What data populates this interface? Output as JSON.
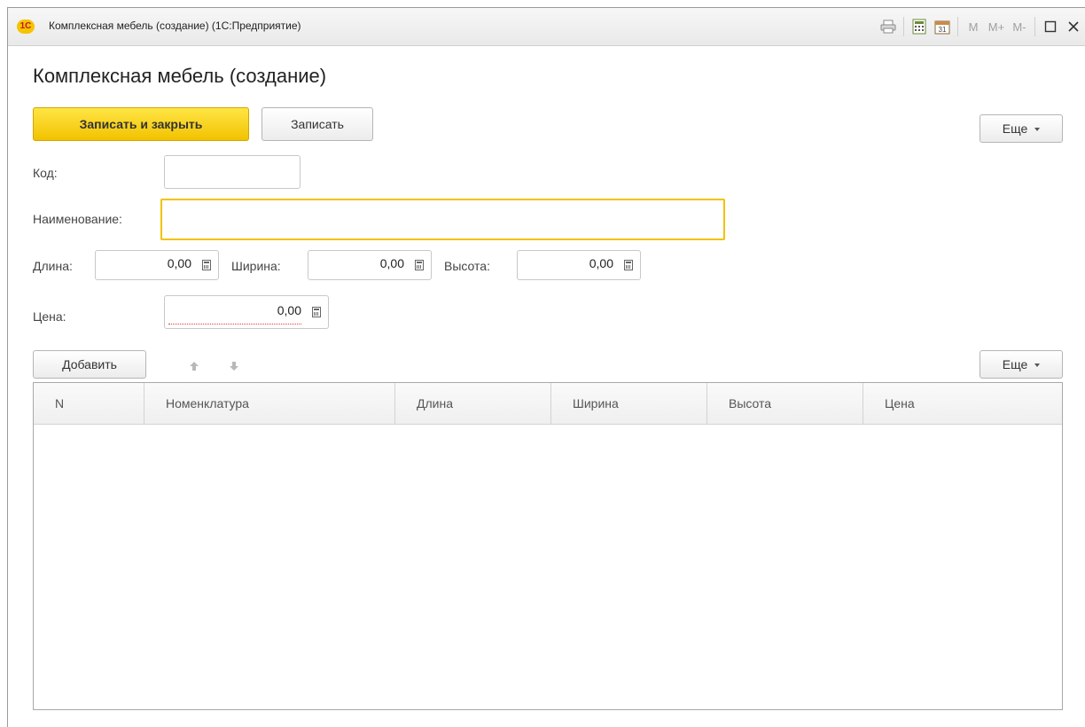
{
  "window": {
    "title": "Комплексная мебель (создание)  (1С:Предприятие)",
    "logo_text": "1С",
    "toolbar_icons": [
      "print-icon",
      "calculator-icon",
      "calendar-icon"
    ],
    "memory_buttons": [
      "M",
      "M+",
      "M-"
    ],
    "window_icons": [
      "maximize-icon",
      "close-icon"
    ]
  },
  "form": {
    "heading": "Комплексная мебель (создание)",
    "toolbar": {
      "save_close_label": "Записать и закрыть",
      "save_label": "Записать",
      "more_label": "Еще"
    },
    "fields": {
      "code_label": "Код:",
      "code_value": "",
      "name_label": "Наименование:",
      "name_value": "",
      "length_label": "Длина:",
      "length_value": "0,00",
      "width_label": "Ширина:",
      "width_value": "0,00",
      "height_label": "Высота:",
      "height_value": "0,00",
      "price_label": "Цена:",
      "price_value": "0,00"
    }
  },
  "table": {
    "add_label": "Добавить",
    "more_label": "Еще",
    "columns": [
      "N",
      "Номенклатура",
      "Длина",
      "Ширина",
      "Высота",
      "Цена"
    ],
    "rows": []
  },
  "colors": {
    "accent": "#F2C200",
    "border": "#C8C8C8",
    "invalid_underline": "#E23B3B"
  }
}
